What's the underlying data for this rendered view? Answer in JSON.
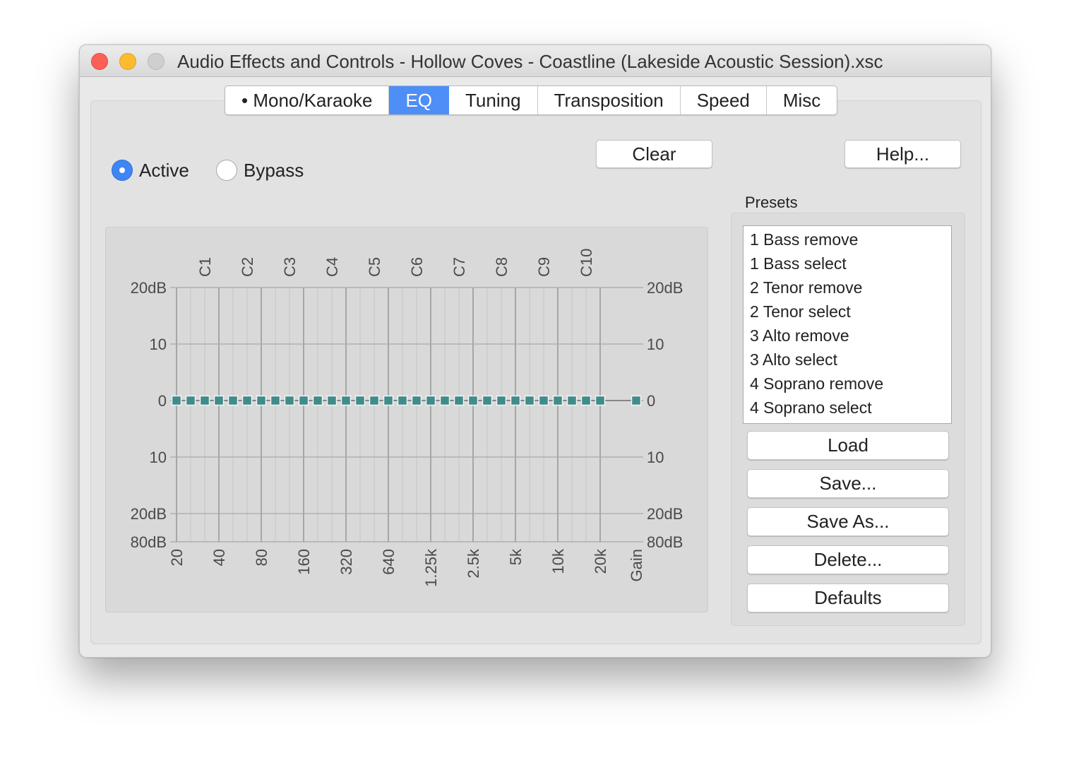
{
  "window": {
    "title": "Audio Effects and Controls - Hollow Coves - Coastline (Lakeside Acoustic Session).xsc"
  },
  "tabs": [
    {
      "label": "• Mono/Karaoke",
      "active": false
    },
    {
      "label": "EQ",
      "active": true
    },
    {
      "label": "Tuning",
      "active": false
    },
    {
      "label": "Transposition",
      "active": false
    },
    {
      "label": "Speed",
      "active": false
    },
    {
      "label": "Misc",
      "active": false
    }
  ],
  "mode": {
    "active_label": "Active",
    "bypass_label": "Bypass",
    "selected": "Active"
  },
  "buttons": {
    "clear": "Clear",
    "help": "Help..."
  },
  "presets": {
    "label": "Presets",
    "items": [
      "1 Bass remove",
      "1 Bass select",
      "2 Tenor remove",
      "2 Tenor select",
      "3 Alto remove",
      "3 Alto select",
      "4 Soprano remove",
      "4 Soprano select"
    ],
    "buttons": {
      "load": "Load",
      "save": "Save...",
      "save_as": "Save As...",
      "delete": "Delete...",
      "defaults": "Defaults"
    }
  },
  "eq": {
    "left_axis_labels": [
      "20dB",
      "10",
      "0",
      "10",
      "20dB",
      "80dB"
    ],
    "right_axis_labels": [
      "20dB",
      "10",
      "0",
      "10",
      "20dB",
      "80dB"
    ],
    "channel_labels": [
      "C1",
      "C2",
      "C3",
      "C4",
      "C5",
      "C6",
      "C7",
      "C8",
      "C9",
      "C10"
    ],
    "frequency_labels": [
      "20",
      "40",
      "80",
      "160",
      "320",
      "640",
      "1.25k",
      "2.5k",
      "5k",
      "10k",
      "20k"
    ],
    "gain_label": "Gain",
    "band_values_db": [
      0,
      0,
      0,
      0,
      0,
      0,
      0,
      0,
      0,
      0,
      0,
      0,
      0,
      0,
      0,
      0,
      0,
      0,
      0,
      0,
      0,
      0,
      0,
      0,
      0,
      0,
      0,
      0,
      0,
      0,
      0
    ],
    "gain_value_db": 0,
    "handle_color": "#3f8c8a"
  }
}
